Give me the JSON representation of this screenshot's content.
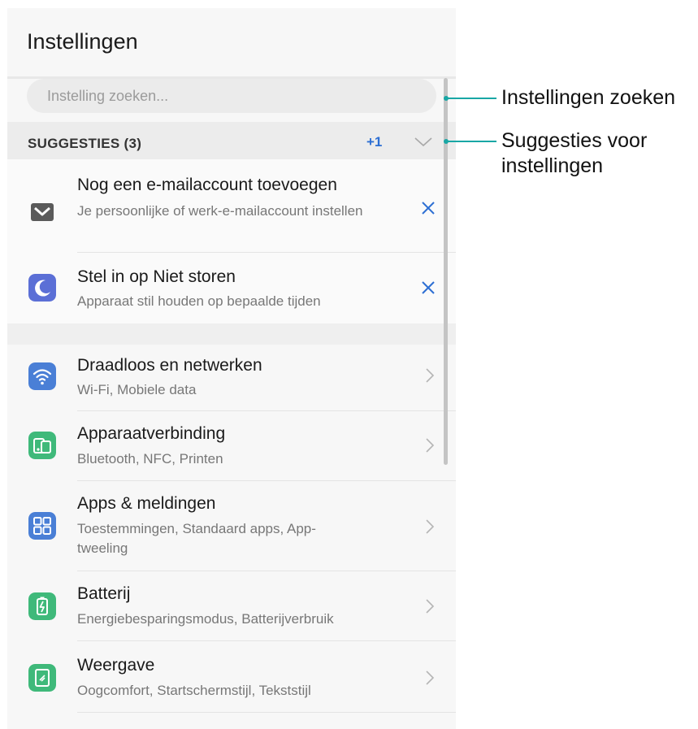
{
  "app": {
    "title": "Instellingen"
  },
  "search": {
    "placeholder": "Instelling zoeken..."
  },
  "suggestions": {
    "header": "SUGGESTIES (3)",
    "more": "+1",
    "items": [
      {
        "title": "Nog een e-mailaccount toevoegen",
        "subtitle": "Je persoonlijke of werk-e-mailaccount instellen",
        "icon": "mail-icon",
        "action": "close-icon"
      },
      {
        "title": "Stel in op Niet storen",
        "subtitle": "Apparaat stil houden op bepaalde tijden",
        "icon": "moon-icon",
        "action": "close-icon"
      }
    ]
  },
  "settings": [
    {
      "title": "Draadloos en netwerken",
      "subtitle": "Wi-Fi, Mobiele data",
      "icon": "wifi-icon",
      "color": "#4a7fd6"
    },
    {
      "title": "Apparaatverbinding",
      "subtitle": "Bluetooth, NFC, Printen",
      "icon": "device-connection-icon",
      "color": "#3fb97a"
    },
    {
      "title": "Apps & meldingen",
      "subtitle": "Toestemmingen, Standaard apps, App-tweeling",
      "icon": "apps-grid-icon",
      "color": "#4a7fd6"
    },
    {
      "title": "Batterij",
      "subtitle": "Energiebesparingsmodus, Batterijverbruik",
      "icon": "battery-icon",
      "color": "#3fb97a"
    },
    {
      "title": "Weergave",
      "subtitle": "Oogcomfort, Startschermstijl, Tekststijl",
      "icon": "display-icon",
      "color": "#3fb97a"
    }
  ],
  "callouts": {
    "search": "Instellingen zoeken",
    "suggestions": "Suggesties voor instellingen"
  },
  "colors": {
    "accent": "#2d6fd3",
    "callout": "#19a7a5",
    "moon": "#5b6fd6",
    "mail": "#5a5a5a"
  }
}
